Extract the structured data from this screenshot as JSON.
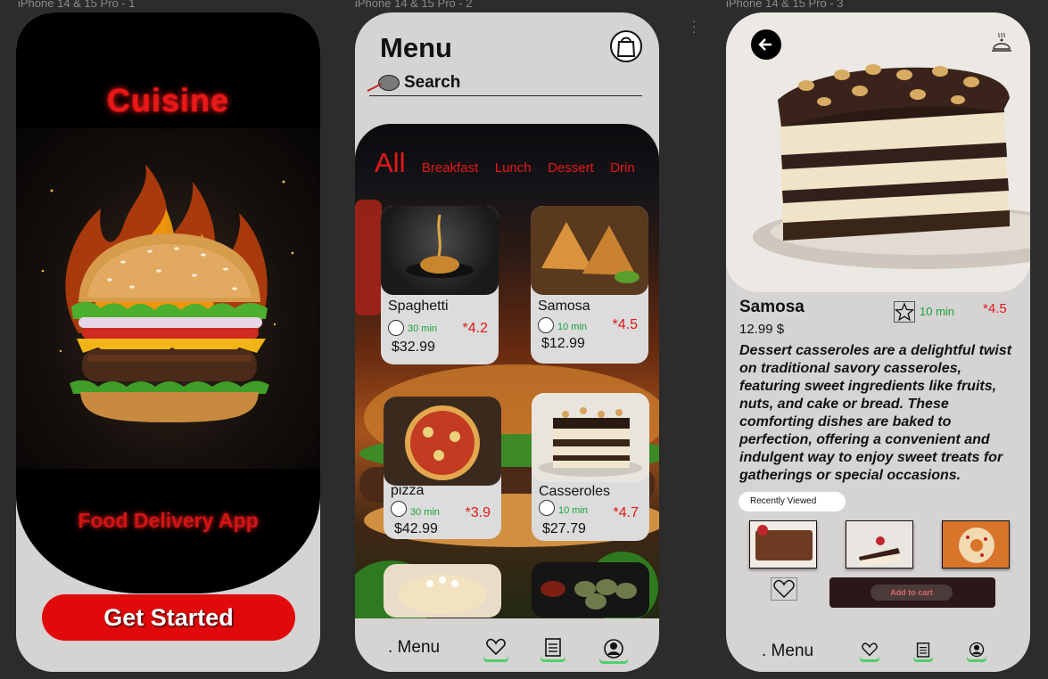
{
  "frames": {
    "frame1_label": "iPhone 14 & 15 Pro - 1",
    "frame2_label": "iPhone 14 & 15 Pro - 2",
    "frame3_label": "iPhone 14 & 15 Pro - 3"
  },
  "splash": {
    "title": "Cuisine",
    "subtitle": "Food Delivery App",
    "cta": "Get Started"
  },
  "menu": {
    "title": "Menu",
    "search_label": "Search",
    "tabs": [
      "All",
      "Breakfast",
      "Lunch",
      "Dessert",
      "Drin"
    ],
    "items": [
      {
        "name": "Spaghetti",
        "time": "30 min",
        "rating": "*4.2",
        "price": "$32.99"
      },
      {
        "name": "Samosa",
        "time": "10 min",
        "rating": "*4.5",
        "price": "$12.99"
      },
      {
        "name": "pizza",
        "time": "30 min",
        "rating": "*3.9",
        "price": "$42.99"
      },
      {
        "name": "Casseroles",
        "time": "10 min",
        "rating": "*4.7",
        "price": "$27.79"
      }
    ],
    "nav_label": ". Menu"
  },
  "detail": {
    "name": "Samosa",
    "time": "10 min",
    "rating": "*4.5",
    "price": "12.99 $",
    "description": "Dessert casseroles are a delightful twist on traditional savory casseroles, featuring sweet ingredients like fruits, nuts, and cake or bread. These comforting dishes are baked to perfection, offering a convenient and indulgent way to enjoy sweet treats for gatherings or special occasions.",
    "recently_viewed": "Recently Viewed",
    "add_to_cart": "Add to cart",
    "nav_label": ". Menu"
  },
  "colors": {
    "accent_red": "#e81818",
    "green": "#19a23a",
    "phone_bg": "#d6d3d3"
  }
}
